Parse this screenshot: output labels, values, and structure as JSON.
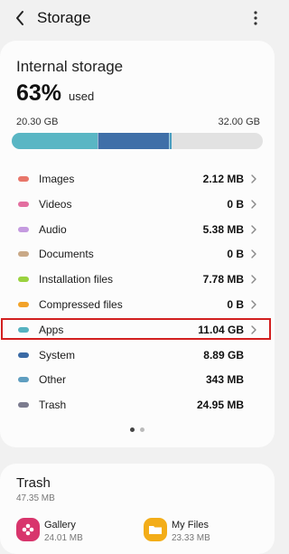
{
  "header": {
    "title": "Storage",
    "back_icon": "chevron-left-icon",
    "more_icon": "more-vertical-icon"
  },
  "storage": {
    "heading": "Internal storage",
    "percent": "63%",
    "used_label": "used",
    "used_amount": "20.30 GB",
    "total_amount": "32.00 GB",
    "segments": [
      {
        "fraction": 0.343,
        "color": "#59b6c4"
      },
      {
        "fraction": 0.28,
        "color": "#3f6fa8"
      },
      {
        "fraction": 0.007,
        "color": "#4a9fc0"
      }
    ]
  },
  "categories": [
    {
      "label": "Images",
      "size": "2.12 MB",
      "color": "#e8766a",
      "chevron": true
    },
    {
      "label": "Videos",
      "size": "0 B",
      "color": "#e36fa0",
      "chevron": true
    },
    {
      "label": "Audio",
      "size": "5.38 MB",
      "color": "#c59be0",
      "chevron": true
    },
    {
      "label": "Documents",
      "size": "0 B",
      "color": "#c9a987",
      "chevron": true
    },
    {
      "label": "Installation files",
      "size": "7.78 MB",
      "color": "#9ad23f",
      "chevron": true
    },
    {
      "label": "Compressed files",
      "size": "0 B",
      "color": "#f2a329",
      "chevron": true
    },
    {
      "label": "Apps",
      "size": "11.04 GB",
      "color": "#56b2c0",
      "chevron": true
    },
    {
      "label": "System",
      "size": "8.89 GB",
      "color": "#3a6aa5",
      "chevron": false
    },
    {
      "label": "Other",
      "size": "343 MB",
      "color": "#5f9ec0",
      "chevron": false
    },
    {
      "label": "Trash",
      "size": "24.95 MB",
      "color": "#7b7b8e",
      "chevron": false
    }
  ],
  "highlighted_category": "Apps",
  "pager": {
    "pages": 2,
    "current": 1
  },
  "trash": {
    "title": "Trash",
    "size": "47.35 MB",
    "apps": [
      {
        "name": "Gallery",
        "size": "24.01 MB",
        "icon": "gallery-icon",
        "color": "#d8356c"
      },
      {
        "name": "My Files",
        "size": "23.33 MB",
        "icon": "folder-icon",
        "color": "#f3ad18"
      }
    ]
  }
}
